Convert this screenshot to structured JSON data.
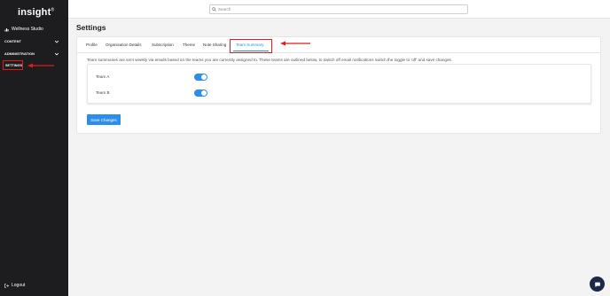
{
  "sidebar": {
    "logo": "insight",
    "org_name": "Wellness Studio",
    "content_label": "CONTENT",
    "administration_label": "ADMINISTRATION",
    "settings_label": "SETTINGS",
    "logout_label": "Logout"
  },
  "search": {
    "placeholder": "Search"
  },
  "main": {
    "title": "Settings",
    "tabs": [
      {
        "label": "Profile"
      },
      {
        "label": "Organisation Details"
      },
      {
        "label": "Subscription"
      },
      {
        "label": "Theme"
      },
      {
        "label": "Note Sharing"
      },
      {
        "label": "Team Summary"
      }
    ],
    "active_tab": "Team Summary",
    "description": "Team summaries are sent weekly via emails based on the teams you are currently assigned to. These teams are outlined below, to switch off email notifications switch the toggle to 'off' and save changes.",
    "teams": [
      {
        "name": "Team A",
        "enabled": true
      },
      {
        "name": "Team B",
        "enabled": true
      }
    ],
    "save_label": "Save Changes"
  },
  "colors": {
    "accent": "#2b8ee8",
    "sidebar_bg": "#1d1d1f",
    "annotation_red": "#e01b1b"
  }
}
